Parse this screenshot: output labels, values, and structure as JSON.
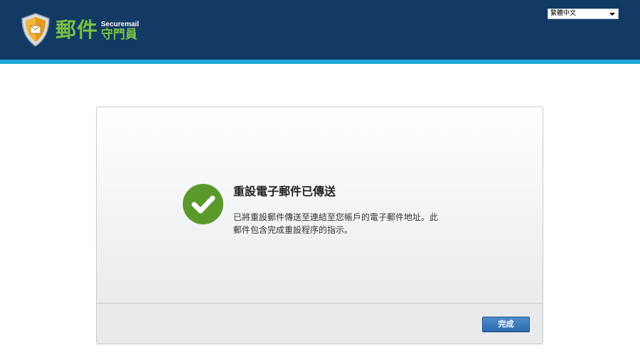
{
  "header": {
    "logo": {
      "icon": "shield-icon",
      "main_text": "郵件",
      "english_text": "Securemail",
      "sub_text": "守門員"
    },
    "language_select": {
      "selected": "繁體中文",
      "icon": "chevron-down-icon"
    },
    "colors": {
      "header_background": "#123a65",
      "stripe": "#1fa7d9",
      "logo_green": "#7cc043"
    }
  },
  "dialog": {
    "status_icon": "checkmark-icon",
    "status_color": "#5a9a2c",
    "title": "重設電子郵件已傳送",
    "body_line1": "已將重設郵件傳送至連結至您帳戶的電子郵件地址。此",
    "body_line2": "郵件包含完成重設程序的指示。",
    "done_button_label": "完成"
  }
}
